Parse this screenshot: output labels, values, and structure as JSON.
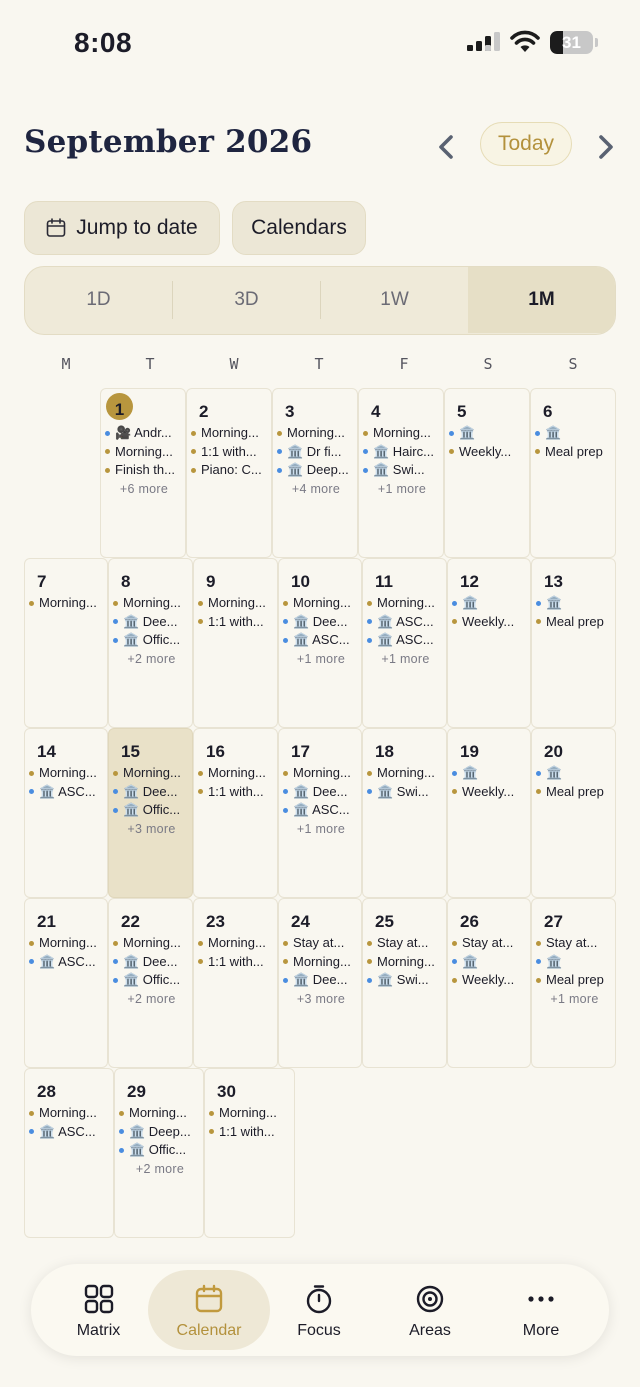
{
  "status_bar": {
    "time": "8:08",
    "battery": "31",
    "battery_level": 0.31
  },
  "header": {
    "title": "September 2026",
    "today_label": "Today",
    "prev_icon": "chevron-left-icon",
    "next_icon": "chevron-right-icon"
  },
  "actions": {
    "jump_label": "Jump to date",
    "calendars_label": "Calendars"
  },
  "views": {
    "items": [
      "1D",
      "3D",
      "1W",
      "1M"
    ],
    "selected": "1M"
  },
  "weekdays": [
    "M",
    "T",
    "W",
    "T",
    "F",
    "S",
    "S"
  ],
  "colors": {
    "accent": "#b8963e",
    "blue_dot": "#4a8de0",
    "gold_dot": "#b8963e",
    "today_bg": "#e9e1c8"
  },
  "weeks": [
    [
      null,
      {
        "day": "1",
        "badge": true,
        "events": [
          [
            "blue",
            "🎥 Andr..."
          ],
          [
            "gold",
            "Morning..."
          ],
          [
            "gold",
            "Finish th..."
          ]
        ],
        "more": "+6 more"
      },
      {
        "day": "2",
        "events": [
          [
            "gold",
            "Morning..."
          ],
          [
            "gold",
            "1:1 with..."
          ],
          [
            "gold",
            "Piano: C..."
          ]
        ]
      },
      {
        "day": "3",
        "events": [
          [
            "gold",
            "Morning..."
          ],
          [
            "blue",
            "🏛️ Dr fi..."
          ],
          [
            "blue",
            "🏛️ Deep..."
          ]
        ],
        "more": "+4 more"
      },
      {
        "day": "4",
        "events": [
          [
            "gold",
            "Morning..."
          ],
          [
            "blue",
            "🏛️ Hairc..."
          ],
          [
            "blue",
            "🏛️ Swi..."
          ]
        ],
        "more": "+1 more"
      },
      {
        "day": "5",
        "events": [
          [
            "blue",
            "🏛️"
          ],
          [
            "gold",
            "Weekly..."
          ]
        ]
      },
      {
        "day": "6",
        "events": [
          [
            "blue",
            "🏛️"
          ],
          [
            "gold",
            "Meal prep"
          ]
        ]
      }
    ],
    [
      {
        "day": "7",
        "events": [
          [
            "gold",
            "Morning..."
          ]
        ]
      },
      {
        "day": "8",
        "events": [
          [
            "gold",
            "Morning..."
          ],
          [
            "blue",
            "🏛️ Dee..."
          ],
          [
            "blue",
            "🏛️ Offic..."
          ]
        ],
        "more": "+2 more"
      },
      {
        "day": "9",
        "events": [
          [
            "gold",
            "Morning..."
          ],
          [
            "gold",
            "1:1 with..."
          ]
        ]
      },
      {
        "day": "10",
        "events": [
          [
            "gold",
            "Morning..."
          ],
          [
            "blue",
            "🏛️ Dee..."
          ],
          [
            "blue",
            "🏛️ ASC..."
          ]
        ],
        "more": "+1 more"
      },
      {
        "day": "11",
        "events": [
          [
            "gold",
            "Morning..."
          ],
          [
            "blue",
            "🏛️ ASC..."
          ],
          [
            "blue",
            "🏛️ ASC..."
          ]
        ],
        "more": "+1 more"
      },
      {
        "day": "12",
        "events": [
          [
            "blue",
            "🏛️"
          ],
          [
            "gold",
            "Weekly..."
          ]
        ]
      },
      {
        "day": "13",
        "events": [
          [
            "blue",
            "🏛️"
          ],
          [
            "gold",
            "Meal prep"
          ]
        ]
      }
    ],
    [
      {
        "day": "14",
        "events": [
          [
            "gold",
            "Morning..."
          ],
          [
            "blue",
            "🏛️ ASC..."
          ]
        ]
      },
      {
        "day": "15",
        "today": true,
        "events": [
          [
            "gold",
            "Morning..."
          ],
          [
            "blue",
            "🏛️ Dee..."
          ],
          [
            "blue",
            "🏛️ Offic..."
          ]
        ],
        "more": "+3 more"
      },
      {
        "day": "16",
        "events": [
          [
            "gold",
            "Morning..."
          ],
          [
            "gold",
            "1:1 with..."
          ]
        ]
      },
      {
        "day": "17",
        "events": [
          [
            "gold",
            "Morning..."
          ],
          [
            "blue",
            "🏛️ Dee..."
          ],
          [
            "blue",
            "🏛️ ASC..."
          ]
        ],
        "more": "+1 more"
      },
      {
        "day": "18",
        "events": [
          [
            "gold",
            "Morning..."
          ],
          [
            "blue",
            "🏛️ Swi..."
          ]
        ]
      },
      {
        "day": "19",
        "events": [
          [
            "blue",
            "🏛️"
          ],
          [
            "gold",
            "Weekly..."
          ]
        ]
      },
      {
        "day": "20",
        "events": [
          [
            "blue",
            "🏛️"
          ],
          [
            "gold",
            "Meal prep"
          ]
        ]
      }
    ],
    [
      {
        "day": "21",
        "events": [
          [
            "gold",
            "Morning..."
          ],
          [
            "blue",
            "🏛️ ASC..."
          ]
        ]
      },
      {
        "day": "22",
        "events": [
          [
            "gold",
            "Morning..."
          ],
          [
            "blue",
            "🏛️ Dee..."
          ],
          [
            "blue",
            "🏛️ Offic..."
          ]
        ],
        "more": "+2 more"
      },
      {
        "day": "23",
        "events": [
          [
            "gold",
            "Morning..."
          ],
          [
            "gold",
            "1:1 with..."
          ]
        ]
      },
      {
        "day": "24",
        "events": [
          [
            "gold",
            "Stay at..."
          ],
          [
            "gold",
            "Morning..."
          ],
          [
            "blue",
            "🏛️ Dee..."
          ]
        ],
        "more": "+3 more"
      },
      {
        "day": "25",
        "events": [
          [
            "gold",
            "Stay at..."
          ],
          [
            "gold",
            "Morning..."
          ],
          [
            "blue",
            "🏛️ Swi..."
          ]
        ]
      },
      {
        "day": "26",
        "events": [
          [
            "gold",
            "Stay at..."
          ],
          [
            "blue",
            "🏛️"
          ],
          [
            "gold",
            "Weekly..."
          ]
        ]
      },
      {
        "day": "27",
        "events": [
          [
            "gold",
            "Stay at..."
          ],
          [
            "blue",
            "🏛️"
          ],
          [
            "gold",
            "Meal prep"
          ]
        ],
        "more": "+1 more"
      }
    ],
    [
      {
        "day": "28",
        "events": [
          [
            "gold",
            "Morning..."
          ],
          [
            "blue",
            "🏛️ ASC..."
          ]
        ]
      },
      {
        "day": "29",
        "events": [
          [
            "gold",
            "Morning..."
          ],
          [
            "blue",
            "🏛️ Deep..."
          ],
          [
            "blue",
            "🏛️ Offic..."
          ]
        ],
        "more": "+2 more"
      },
      {
        "day": "30",
        "events": [
          [
            "gold",
            "Morning..."
          ],
          [
            "gold",
            "1:1 with..."
          ]
        ]
      }
    ]
  ],
  "tabbar": {
    "items": [
      {
        "label": "Matrix",
        "icon": "grid-icon"
      },
      {
        "label": "Calendar",
        "icon": "calendar-icon",
        "active": true
      },
      {
        "label": "Focus",
        "icon": "timer-icon"
      },
      {
        "label": "Areas",
        "icon": "target-icon"
      },
      {
        "label": "More",
        "icon": "more-icon"
      }
    ]
  }
}
